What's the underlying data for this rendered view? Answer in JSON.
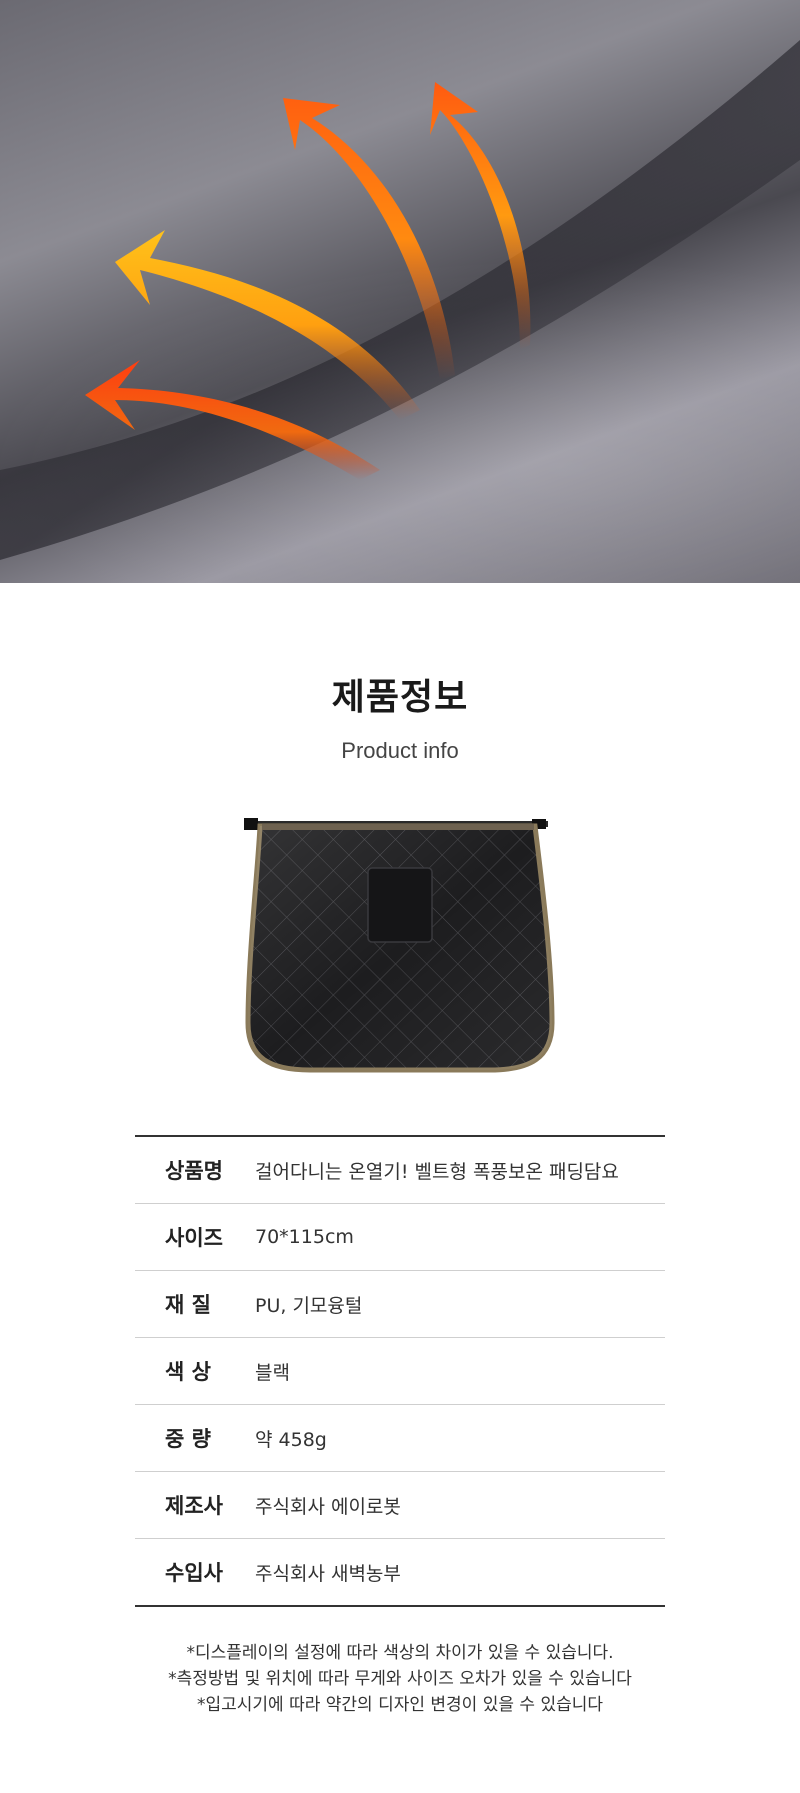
{
  "hero": {
    "icon": "heat-arrows-icon"
  },
  "title": {
    "ko": "제품정보",
    "en": "Product info"
  },
  "product": {
    "name": "product-image",
    "color": "#1c1c1c",
    "trim": "#8a7a5a"
  },
  "spec": {
    "rows": [
      {
        "key": "상품명",
        "value": "걸어다니는 온열기! 벨트형 폭풍보온 패딩담요"
      },
      {
        "key": "사이즈",
        "value": "70*115cm"
      },
      {
        "key": "재 질",
        "value": "PU, 기모융털"
      },
      {
        "key": "색 상",
        "value": "블랙"
      },
      {
        "key": "중 량",
        "value": "약 458g"
      },
      {
        "key": "제조사",
        "value": "주식회사 에이로봇"
      },
      {
        "key": "수입사",
        "value": "주식회사 새벽농부"
      }
    ]
  },
  "notes": [
    "*디스플레이의 설정에 따라 색상의 차이가 있을 수 있습니다.",
    "*측정방법 및 위치에 따라 무게와 사이즈 오차가 있을 수 있습니다",
    "*입고시기에 따라 약간의 디자인 변경이 있을 수 있습니다"
  ]
}
